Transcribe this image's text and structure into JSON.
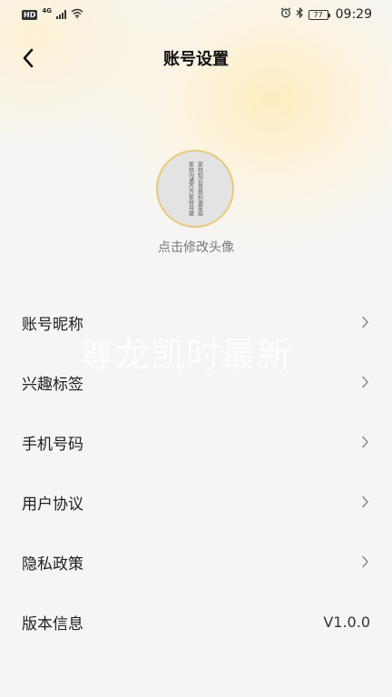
{
  "status_bar": {
    "left_badge": "HD",
    "network": "4G",
    "battery": "77",
    "time": "09:29"
  },
  "nav": {
    "title": "账号设置",
    "back_icon": "chevron-left-icon"
  },
  "avatar": {
    "poem_columns": [
      "家校知识意慈和谐家庭",
      "家校沟通齐齐家校共建"
    ],
    "caption": "点击修改头像"
  },
  "watermark": "尊龙凯时最新",
  "menu": {
    "items": [
      {
        "label": "账号昵称",
        "icon": "chevron-right-icon"
      },
      {
        "label": "兴趣标签",
        "icon": "chevron-right-icon"
      },
      {
        "label": "手机号码",
        "icon": "chevron-right-icon"
      },
      {
        "label": "用户协议",
        "icon": "chevron-right-icon"
      },
      {
        "label": "隐私政策",
        "icon": "chevron-right-icon"
      },
      {
        "label": "版本信息",
        "value": "V1.0.0"
      }
    ]
  },
  "colors": {
    "accent_gold": "#e8c97a",
    "background": "#f5f5f5"
  }
}
